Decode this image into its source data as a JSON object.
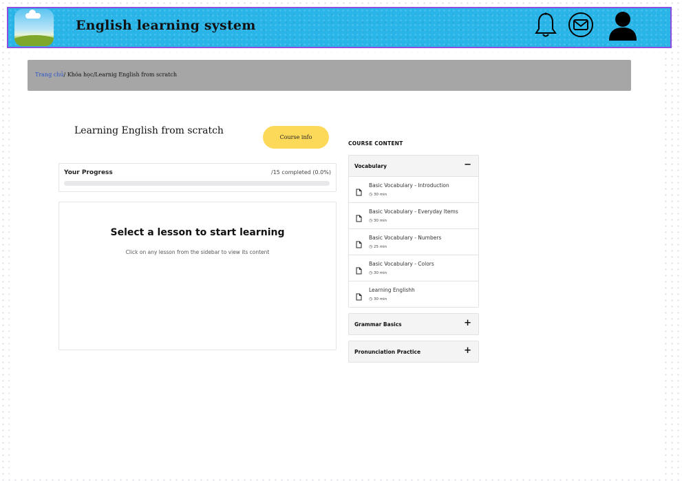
{
  "header": {
    "title": "English learning system",
    "icons": [
      "bell-icon",
      "mail-icon",
      "user-icon"
    ]
  },
  "breadcrumb": {
    "home": "Trang chủ",
    "rest": "/ Khóa học/Learnig English from scratch"
  },
  "course": {
    "title": "Learning English from scratch",
    "info_button": "Course info"
  },
  "progress": {
    "label": "Your Progress",
    "count": "/15 completed (0.0%)",
    "fraction": 0.0
  },
  "viewer": {
    "title": "Select a lesson to start learning",
    "subtitle": "Click on any lesson from the sidebar to view its content"
  },
  "sidebar": {
    "heading": "COURSE CONTENT",
    "sections": [
      {
        "name": "Vocabulary",
        "toggle": "−",
        "lessons": [
          {
            "title": "Basic Vocabulary - Introduction",
            "duration": "30 min"
          },
          {
            "title": "Basic Vocabulary - Everyday Items",
            "duration": "30 min"
          },
          {
            "title": "Basic Vocabulary - Numbers",
            "duration": "25 min"
          },
          {
            "title": "Basic Vocabulary - Colors",
            "duration": "30 min"
          },
          {
            "title": "Learning Englishh",
            "duration": "30 min"
          }
        ]
      },
      {
        "name": "Grammar Basics",
        "toggle": "+"
      },
      {
        "name": "Pronunciation Practice",
        "toggle": "+"
      }
    ]
  },
  "colors": {
    "header_bg": "#29b5e8",
    "header_border": "#8a4fe0",
    "breadcrumb_bg": "#a6a6a6",
    "accent_button": "#fdd95a",
    "link": "#2a54c8"
  }
}
